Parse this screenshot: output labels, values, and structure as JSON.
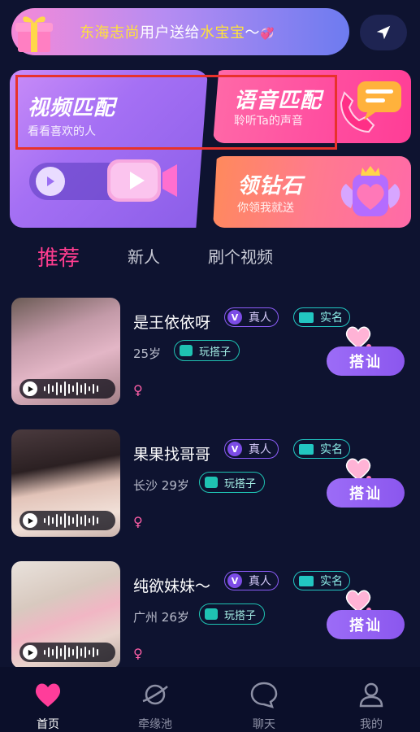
{
  "banner": {
    "sender": "东海志尚",
    "middle": "用户送给",
    "receiver": "水宝宝",
    "suffix": "〜"
  },
  "cards": {
    "video": {
      "title": "视频匹配",
      "subtitle": "看看喜欢的人"
    },
    "voice": {
      "title": "语音匹配",
      "subtitle": "聆听Ta的声音"
    },
    "diamond": {
      "title": "领钻石",
      "subtitle": "你领我就送"
    }
  },
  "tabs": [
    "推荐",
    "新人",
    "刷个视频"
  ],
  "users": [
    {
      "name": "是王依依呀",
      "verified_label": "真人",
      "realname_label": "实名",
      "location": "",
      "age": "25岁",
      "tag": "玩搭子",
      "gender": "♀",
      "action": "搭讪"
    },
    {
      "name": "果果找哥哥",
      "verified_label": "真人",
      "realname_label": "实名",
      "location": "长沙",
      "age": "29岁",
      "tag": "玩搭子",
      "gender": "♀",
      "action": "搭讪"
    },
    {
      "name": "纯欲妹妹〜",
      "verified_label": "真人",
      "realname_label": "实名",
      "location": "广州",
      "age": "26岁",
      "tag": "玩搭子",
      "gender": "♀",
      "action": "搭讪"
    }
  ],
  "nav": [
    {
      "label": "首页",
      "icon": "heart-icon",
      "active": true
    },
    {
      "label": "牵缘池",
      "icon": "planet-icon",
      "active": false
    },
    {
      "label": "聊天",
      "icon": "chat-bubble-icon",
      "active": false
    },
    {
      "label": "我的",
      "icon": "person-icon",
      "active": false
    }
  ],
  "colors": {
    "background": "#0e1330",
    "accent_pink": "#ff3d8f",
    "accent_purple": "#8b57ee",
    "highlight_yellow": "#ffe23a",
    "annotation_red": "#e8322b"
  }
}
